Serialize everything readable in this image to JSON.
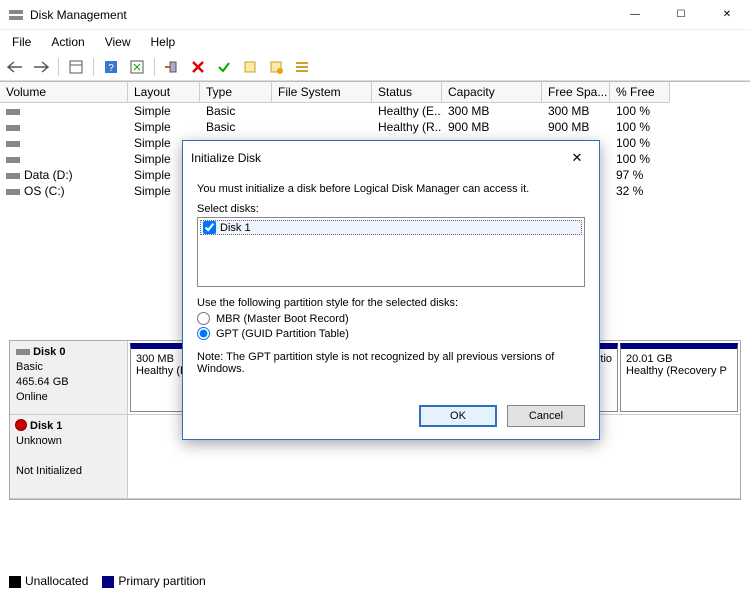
{
  "window": {
    "title": "Disk Management",
    "controls": {
      "min": "—",
      "max": "☐",
      "close": "✕"
    }
  },
  "menu": [
    "File",
    "Action",
    "View",
    "Help"
  ],
  "columns": {
    "volume": "Volume",
    "layout": "Layout",
    "type": "Type",
    "fs": "File System",
    "status": "Status",
    "capacity": "Capacity",
    "free": "Free Spa...",
    "pct": "% Free"
  },
  "volumes": [
    {
      "name": "",
      "layout": "Simple",
      "type": "Basic",
      "fs": "",
      "status": "Healthy (E...",
      "capacity": "300 MB",
      "free": "300 MB",
      "pct": "100 %"
    },
    {
      "name": "",
      "layout": "Simple",
      "type": "Basic",
      "fs": "",
      "status": "Healthy (R...",
      "capacity": "900 MB",
      "free": "900 MB",
      "pct": "100 %"
    },
    {
      "name": "",
      "layout": "Simple",
      "type": "",
      "fs": "",
      "status": "",
      "capacity": "",
      "free": "",
      "pct": "100 %"
    },
    {
      "name": "",
      "layout": "Simple",
      "type": "",
      "fs": "",
      "status": "",
      "capacity": "",
      "free": "B",
      "pct": "100 %"
    },
    {
      "name": "Data (D:)",
      "layout": "Simple",
      "type": "",
      "fs": "",
      "status": "",
      "capacity": "",
      "free": "GB",
      "pct": "97 %"
    },
    {
      "name": "OS (C:)",
      "layout": "Simple",
      "type": "",
      "fs": "",
      "status": "",
      "capacity": "",
      "free": "B",
      "pct": "32 %"
    }
  ],
  "disks": [
    {
      "name": "Disk 0",
      "type": "Basic",
      "size": "465.64 GB",
      "status": "Online",
      "bad": false,
      "partitions": [
        {
          "label": "",
          "size": "300 MB",
          "status": "Healthy (E"
        },
        {
          "label": "",
          "size": "",
          "status": "rtitio"
        },
        {
          "label": "",
          "size": "20.01 GB",
          "status": "Healthy (Recovery P"
        }
      ]
    },
    {
      "name": "Disk 1",
      "type": "Unknown",
      "size": "",
      "status": "Not Initialized",
      "bad": true,
      "partitions": []
    }
  ],
  "legend": {
    "unalloc": "Unallocated",
    "primary": "Primary partition"
  },
  "dialog": {
    "title": "Initialize Disk",
    "message": "You must initialize a disk before Logical Disk Manager can access it.",
    "select_label": "Select disks:",
    "disk_item": "Disk 1",
    "style_label": "Use the following partition style for the selected disks:",
    "mbr": "MBR (Master Boot Record)",
    "gpt": "GPT (GUID Partition Table)",
    "note": "Note: The GPT partition style is not recognized by all previous versions of Windows.",
    "ok": "OK",
    "cancel": "Cancel"
  }
}
